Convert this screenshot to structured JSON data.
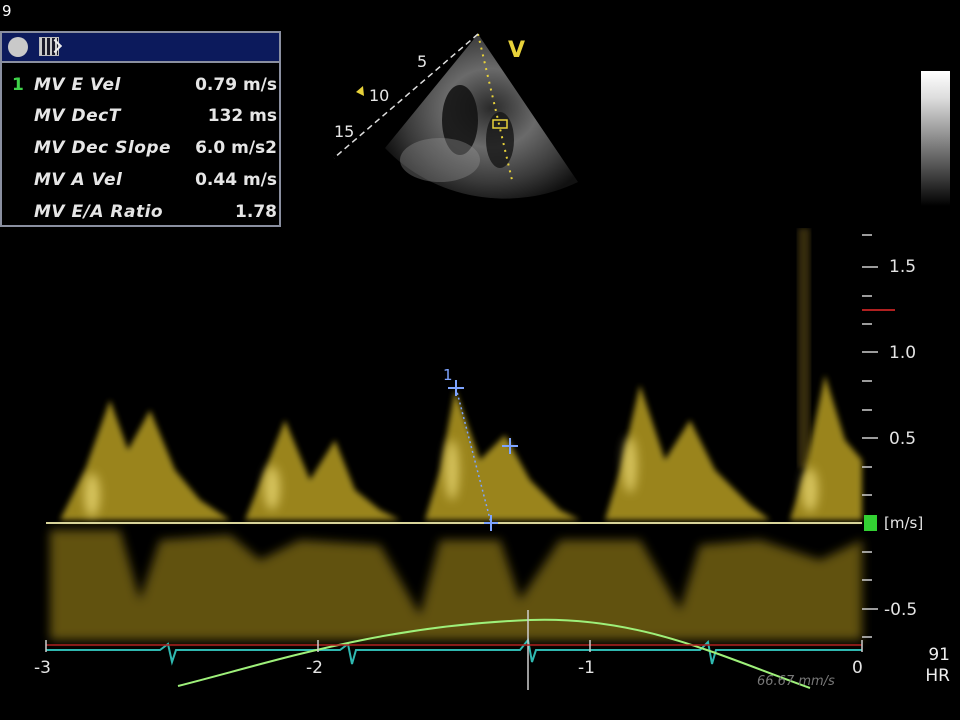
{
  "corner_label": "9",
  "measurements": {
    "active_index": "1",
    "rows": [
      {
        "label": "MV E Vel",
        "value": "0.79 m/s"
      },
      {
        "label": "MV DecT",
        "value": "132 ms"
      },
      {
        "label": "MV Dec Slope",
        "value": "6.0 m/s2"
      },
      {
        "label": "MV A Vel",
        "value": "0.44 m/s"
      },
      {
        "label": "MV E/A Ratio",
        "value": "1.78"
      }
    ]
  },
  "image_2d": {
    "view_marker": "V",
    "depth_labels": [
      "5",
      "10",
      "15"
    ]
  },
  "doppler": {
    "velocity_unit": "[m/s]",
    "velocity_ticks": [
      "1.5",
      "1.0",
      "0.5",
      "-0.5"
    ],
    "time_ticks": [
      "-3",
      "-2",
      "-1",
      "0"
    ],
    "sweep_speed": "66.67 mm/s",
    "measurement_marker": "1"
  },
  "heart_rate": {
    "value": "91",
    "label": "HR"
  },
  "colors": {
    "spectrum": "#d8c23a",
    "baseline": "#d8d49a",
    "ecg": "#2fb8b0",
    "resp_trace": "#9ef07a",
    "caliper": "#7ea4ff",
    "active_index": "#3fd24a",
    "panel_header": "#0c1a5c"
  }
}
